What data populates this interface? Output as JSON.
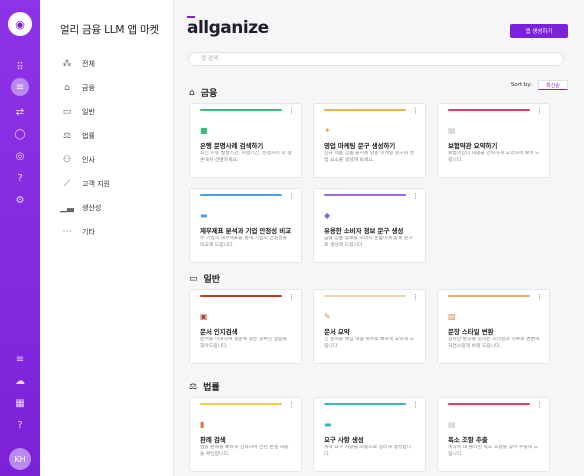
{
  "app": {
    "title": "얼리 금융 LLM 앱 마켓",
    "brand": "allganize",
    "avatar_initials": "KH",
    "accent": "#7b22d9"
  },
  "sidebar": {
    "items": [
      {
        "icon": "grid-icon",
        "label": "전체"
      },
      {
        "icon": "bank-icon",
        "label": "금융"
      },
      {
        "icon": "briefcase-icon",
        "label": "일반"
      },
      {
        "icon": "gavel-icon",
        "label": "법률"
      },
      {
        "icon": "people-icon",
        "label": "인사"
      },
      {
        "icon": "chart-line-icon",
        "label": "고객 지원"
      },
      {
        "icon": "bar-chart-icon",
        "label": "생산성"
      },
      {
        "icon": "ellipsis-icon",
        "label": "기타"
      }
    ]
  },
  "header": {
    "new_app_label": "앱 생성하기",
    "search_placeholder": "앱 검색..",
    "sort_label": "Sort by:",
    "sort_value": "최신순"
  },
  "sections": [
    {
      "title": "금융",
      "icon": "bank-icon",
      "cards": [
        {
          "color": "#3dbb7a",
          "icon": "■",
          "icon_color": "#3dbb7a",
          "title": "은행 문명사례 검색하기",
          "desc": "최신 이슈 발생기관, 시행기간, 은행사이 의 결론에서 선별하세요."
        },
        {
          "color": "#f0b44c",
          "icon": "✦",
          "icon_color": "#f0a040",
          "title": "영업 마케팅 문구 생성하기",
          "desc": "신규 제품 상품 출시에 맞춘 마케팅 문구와 영업 요소를 생성해 보세요."
        },
        {
          "color": "#e0405a",
          "icon": "▤",
          "icon_color": "#bbbbbb",
          "title": "보험약관 요약하기",
          "desc": "보험약관의 내용을 간략하게 요약하여 보여 드립니다."
        },
        {
          "color": "#4aa3df",
          "icon": "▬",
          "icon_color": "#4aa3df",
          "title": "재무제표 분석과 기업 안정성 비교",
          "desc": "두 기업의 재무제표를 통해 기업의 안정성을 비교해 드립니다."
        },
        {
          "color": "#9a6adf",
          "icon": "◆",
          "icon_color": "#7b6adf",
          "title": "유용한 소비자 정보 문구 생성",
          "desc": "금융 상품 정보를 소비자 눈높이에 맞게 문구로 생성해 드립니다."
        }
      ]
    },
    {
      "title": "일반",
      "icon": "briefcase-icon",
      "cards": [
        {
          "color": "#c0392b",
          "icon": "▣",
          "icon_color": "#b04a3a",
          "title": "문서 인지검색",
          "desc": "문서를 이해하여 질문에 맞는 정확한 정답을 찾아드립니다."
        },
        {
          "color": "#e8d6b0",
          "icon": "✎",
          "icon_color": "#c99a5a",
          "title": "문서 요약",
          "desc": "긴 문서를 핵심 내용 위주로 빠르게 요약해 드립니다."
        },
        {
          "color": "#f0a868",
          "icon": "▧",
          "icon_color": "#e09050",
          "title": "문장 스타일 변환",
          "desc": "입력한 문장을 원하는 스타일과 어투로 변환해 자연스럽게 바꿔 드립니다."
        }
      ]
    },
    {
      "title": "법률",
      "icon": "gavel-icon",
      "cards": [
        {
          "color": "#f0c84c",
          "icon": "▮",
          "icon_color": "#e07040",
          "title": "판례 검색",
          "desc": "법률 판례를 빠르게 검색하여 관련 판결 내용을 확인합니다."
        },
        {
          "color": "#3dbbb0",
          "icon": "▬",
          "icon_color": "#3dbbb0",
          "title": "요구 사항 생성",
          "desc": "계약 요구 사항을 자동으로 정리해 생성합니다."
        },
        {
          "color": "#e0405a",
          "icon": "▤",
          "icon_color": "#bbbbbb",
          "title": "독소 조항 추출",
          "desc": "계약서 내 불리한 독소 조항을 찾아 추출해 드립니다."
        }
      ]
    }
  ]
}
